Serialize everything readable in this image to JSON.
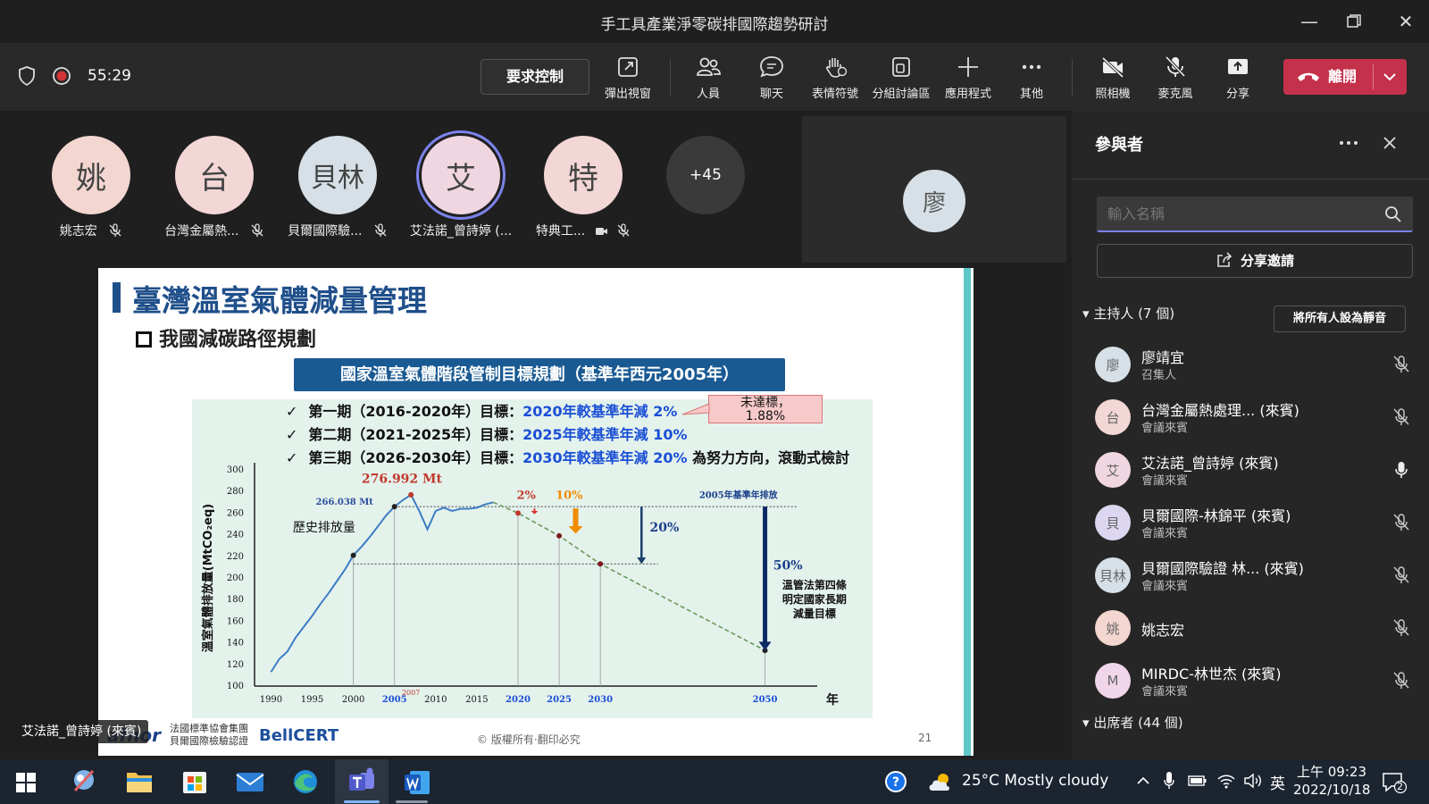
{
  "window": {
    "title": "手工具產業淨零碳排國際趨勢研討"
  },
  "toolbar": {
    "timer": "55:29",
    "request_control": "要求控制",
    "items": [
      "彈出視窗",
      "人員",
      "聊天",
      "表情符號",
      "分組討論區",
      "應用程式",
      "其他",
      "照相機",
      "麥克風",
      "分享"
    ],
    "leave": "離開"
  },
  "stage": {
    "avatars": [
      {
        "initial": "姚",
        "name": "姚志宏",
        "color": "#f3d6d0"
      },
      {
        "initial": "台",
        "name": "台灣金屬熱...",
        "color": "#f3d6d0"
      },
      {
        "initial": "貝林",
        "name": "貝爾國際驗...",
        "color": "#d6e0e6"
      },
      {
        "initial": "艾",
        "name": "艾法諾_曾詩婷 (...",
        "color": "#f0d6e0"
      },
      {
        "initial": "特",
        "name": "特典工...",
        "color": "#f3d6d6"
      }
    ],
    "overflow": "+45",
    "tile_initial": "廖",
    "speaker_label": "艾法諾_曾詩婷 (來賓)"
  },
  "slide": {
    "title": "臺灣溫室氣體減量管理",
    "subtitle": "我國減碳路徑規劃",
    "banner": "國家溫室氣體階段管制目標規劃（基準年西元2005年）",
    "bullets": [
      {
        "prefix": "第一期（2016-2020年）目標：",
        "target": "2020年較基準年減 2%",
        "suffix": ""
      },
      {
        "prefix": "第二期（2021-2025年）目標：",
        "target": "2025年較基準年減 10%",
        "suffix": ""
      },
      {
        "prefix": "第三期（2026-2030年）目標：",
        "target": "2030年較基準年減 20%",
        "suffix": " 為努力方向，滾動式檢討"
      }
    ],
    "callout": "未達標，\n1.88%",
    "footer_org": "法國標準協會集團\n貝爾國際檢驗認證",
    "footer_brand": "BellCERT",
    "footer_logo": "afnor",
    "copyright": "© 版權所有·翻印必究",
    "page": "21"
  },
  "chart_data": {
    "type": "line",
    "ylabel": "溫室氣體排放量(MtCO₂eq)",
    "xlabel": "年",
    "yticks": [
      100,
      120,
      140,
      160,
      180,
      200,
      220,
      240,
      260,
      280,
      300
    ],
    "xticks": [
      "1990",
      "1995",
      "2000",
      "2005",
      "2010",
      "2015",
      "2020",
      "2025",
      "2030",
      "2050"
    ],
    "ylim": [
      100,
      300
    ],
    "annotations": {
      "history": "歷史排放量",
      "baseline_value": "266.038 Mt",
      "peak_value": "276.992 Mt",
      "peak_year": "2007",
      "baseline_label": "2005年基準年排放",
      "pct_2": "2%",
      "pct_10": "10%",
      "pct_20": "20%",
      "pct_50": "50%",
      "note": [
        "溫管法第四條",
        "明定國家長期",
        "減量目標"
      ]
    },
    "series": [
      {
        "name": "歷史排放量",
        "x": [
          1990,
          1991,
          1992,
          1993,
          1994,
          1995,
          1996,
          1997,
          1998,
          1999,
          2000,
          2001,
          2002,
          2003,
          2004,
          2005,
          2006,
          2007,
          2008,
          2009,
          2010,
          2011,
          2012,
          2013,
          2014,
          2015,
          2016,
          2017
        ],
        "y": [
          113,
          125,
          132,
          145,
          155,
          165,
          176,
          186,
          197,
          208,
          221,
          229,
          238,
          248,
          258,
          266,
          272,
          277,
          262,
          245,
          262,
          265,
          262,
          264,
          264,
          265,
          268,
          270
        ]
      },
      {
        "name": "減量路徑",
        "x": [
          2017,
          2020,
          2025,
          2030,
          2050
        ],
        "y": [
          270,
          260,
          239,
          213,
          133
        ]
      }
    ]
  },
  "participants": {
    "title": "參與者",
    "search_placeholder": "輸入名稱",
    "share_invite": "分享邀請",
    "hosts_header": "主持人 (7 個)",
    "mute_all": "將所有人設為靜音",
    "attendees_header": "出席者 (44 個)",
    "list": [
      {
        "initial": "廖",
        "name": "廖靖宜",
        "role": "召集人",
        "color": "#d6e0e6",
        "mic": "off"
      },
      {
        "initial": "台",
        "name": "台灣金屬熱處理... (來賓)",
        "role": "會議來賓",
        "color": "#f3d6d6",
        "mic": "off"
      },
      {
        "initial": "艾",
        "name": "艾法諾_曾詩婷 (來賓)",
        "role": "會議來賓",
        "color": "#f0d6e0",
        "mic": "on"
      },
      {
        "initial": "貝",
        "name": "貝爾國際-林錦平 (來賓)",
        "role": "會議來賓",
        "color": "#dcd6f0",
        "mic": "off"
      },
      {
        "initial": "貝林",
        "name": "貝爾國際驗證 林... (來賓)",
        "role": "會議來賓",
        "color": "#d6e0e6",
        "mic": "off"
      },
      {
        "initial": "姚",
        "name": "姚志宏",
        "role": "",
        "color": "#f3d6d0",
        "mic": "off"
      },
      {
        "initial": "M",
        "name": "MIRDC-林世杰 (來賓)",
        "role": "會議來賓",
        "color": "#f0d6e8",
        "mic": "off"
      }
    ]
  },
  "taskbar": {
    "weather": "25°C  Mostly cloudy",
    "ime": "英",
    "time": "上午 09:23",
    "date": "2022/10/18",
    "notifications": "2"
  }
}
